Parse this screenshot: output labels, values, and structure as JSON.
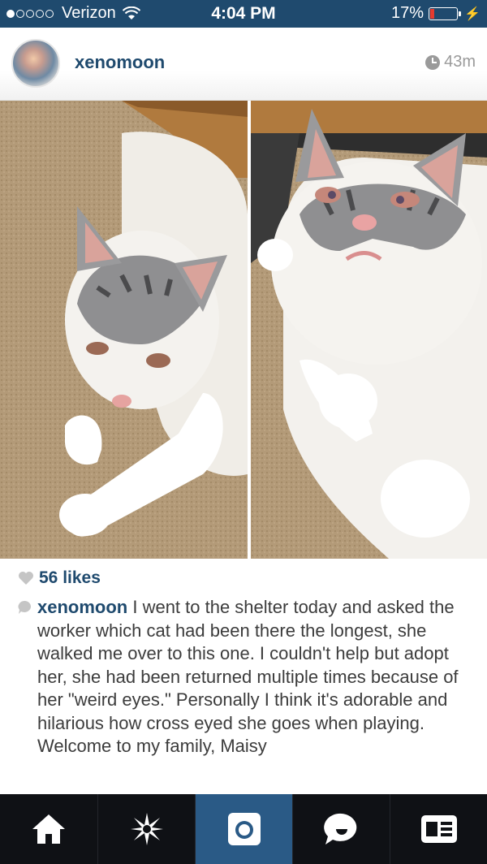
{
  "status_bar": {
    "carrier": "Verizon",
    "time": "4:04 PM",
    "battery": "17%",
    "signal_bars": 1
  },
  "post": {
    "username": "xenomoon",
    "age": "43m",
    "likes": "56 likes",
    "caption_user": "xenomoon",
    "caption_text": " I went to the shelter today and asked the worker which cat had been there the longest, she walked me over to this one. I couldn't help but adopt her, she had been returned multiple times because of her \"weird eyes.\" Personally I think it's adorable and hilarious how cross eyed she goes when playing. Welcome to my family, Maisy"
  },
  "tabs": [
    {
      "name": "home",
      "icon": "home-icon"
    },
    {
      "name": "explore",
      "icon": "star-icon"
    },
    {
      "name": "camera",
      "icon": "camera-icon"
    },
    {
      "name": "news",
      "icon": "speech-bubble-icon"
    },
    {
      "name": "profile",
      "icon": "profile-card-icon"
    }
  ],
  "colors": {
    "brand": "#1f4a6e",
    "active_tab": "#2a5a86",
    "tabbar": "#0f1115",
    "battery_low": "#e53b2f"
  }
}
